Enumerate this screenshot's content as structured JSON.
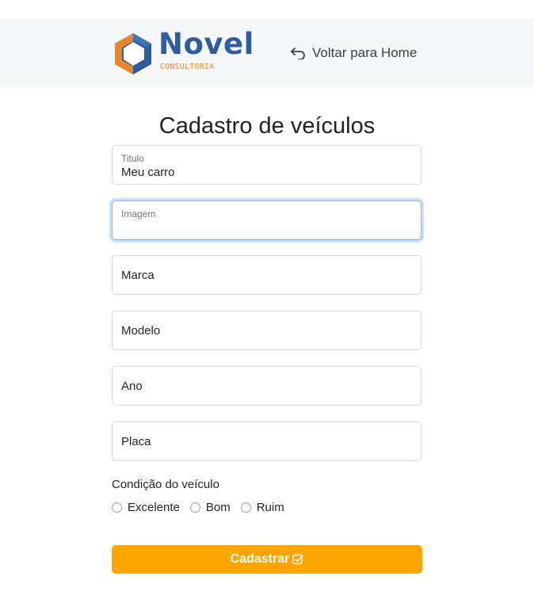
{
  "header": {
    "logo": {
      "wordmark": "Novel",
      "subtitle": "CONSULTORIA"
    },
    "back_link": {
      "label": "Voltar para Home",
      "icon": "undo-arrow-icon"
    }
  },
  "page": {
    "title": "Cadastro de veículos"
  },
  "form": {
    "titulo": {
      "label": "Titulo",
      "value": "Meu carro"
    },
    "imagem": {
      "label": "Imagem",
      "value": ""
    },
    "marca": {
      "placeholder": "Marca"
    },
    "modelo": {
      "placeholder": "Modelo"
    },
    "ano": {
      "placeholder": "Ano"
    },
    "placa": {
      "placeholder": "Placa"
    },
    "condicao": {
      "label": "Condição do veículo",
      "options": [
        "Excelente",
        "Bom",
        "Ruim"
      ],
      "selected": null
    },
    "submit": {
      "label": "Cadastrar",
      "icon": "check-square-icon"
    }
  },
  "colors": {
    "accent": "#ffa500",
    "brand_blue": "#2e5c9c",
    "brand_orange": "#e8862a",
    "focus": "#86b7fe"
  }
}
